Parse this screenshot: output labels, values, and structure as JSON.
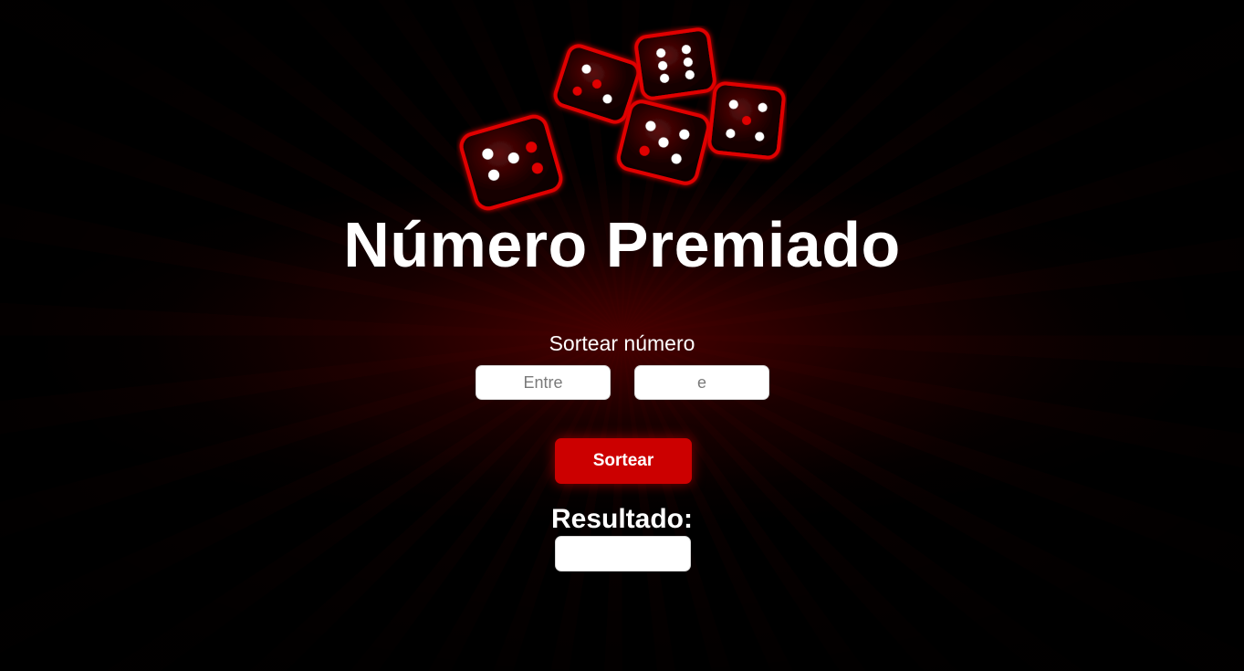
{
  "header": {
    "title": "Número Premiado"
  },
  "form": {
    "subtitle": "Sortear número",
    "min_placeholder": "Entre",
    "max_placeholder": "e",
    "min_value": "",
    "max_value": "",
    "submit_label": "Sortear"
  },
  "result": {
    "label": "Resultado:",
    "value": ""
  },
  "decoration": {
    "icon": "dice-icon",
    "dice_count": 5
  },
  "colors": {
    "background": "#000000",
    "accent": "#cc0000",
    "text": "#ffffff"
  }
}
